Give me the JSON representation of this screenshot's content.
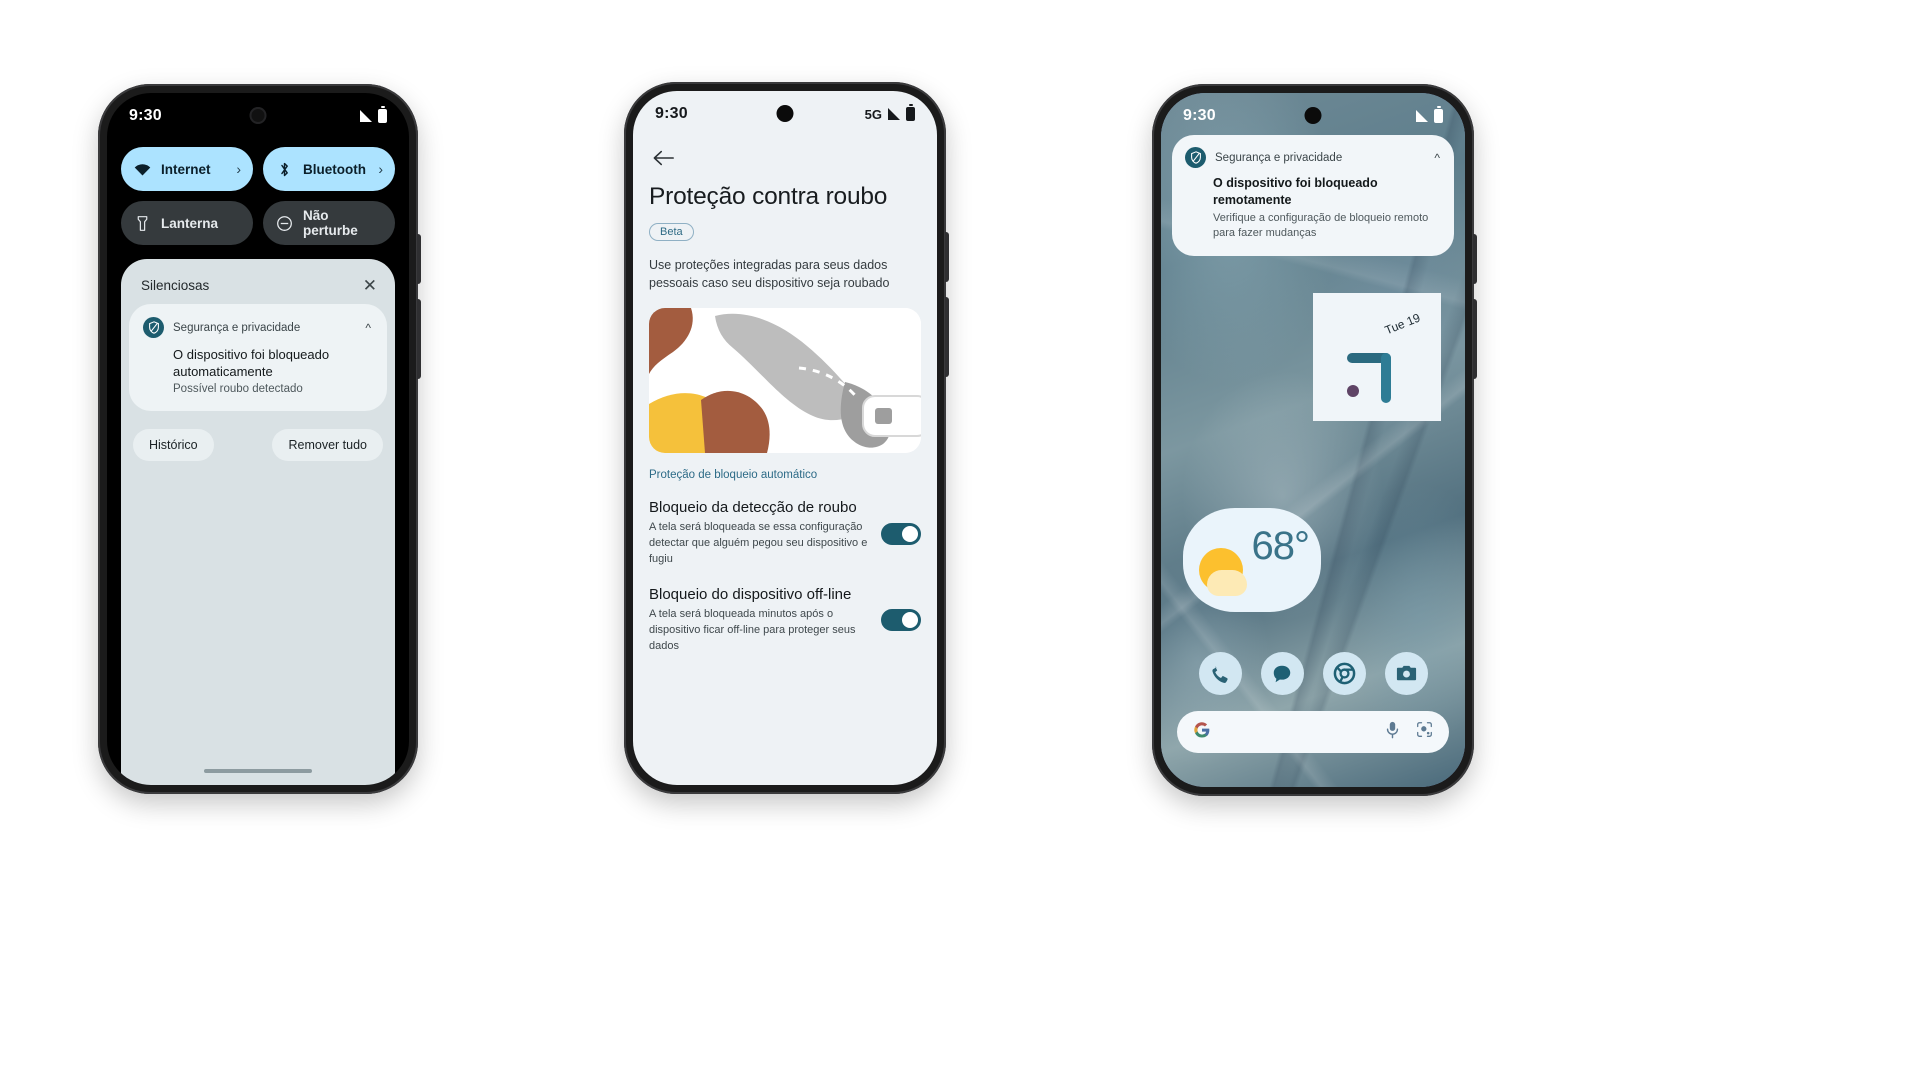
{
  "phone1": {
    "status": {
      "time": "9:30",
      "signal_icon": "signal-bars-icon",
      "battery_icon": "battery-icon"
    },
    "quick_settings": [
      {
        "label": "Internet",
        "icon": "wifi-icon",
        "state": "on",
        "chevron": "›"
      },
      {
        "label": "Bluetooth",
        "icon": "bluetooth-icon",
        "state": "on",
        "chevron": "›"
      },
      {
        "label": "Lanterna",
        "icon": "flashlight-icon",
        "state": "off",
        "chevron": ""
      },
      {
        "label": "Não perturbe",
        "icon": "do-not-disturb-icon",
        "state": "off",
        "chevron": ""
      }
    ],
    "shade": {
      "section_title": "Silenciosas",
      "close_icon": "close-icon",
      "notification": {
        "app": "Segurança e privacidade",
        "app_icon": "shield-icon",
        "collapse_icon": "chevron-up-icon",
        "title": "O dispositivo foi bloqueado automaticamente",
        "subtitle": "Possível roubo detectado"
      },
      "actions": {
        "history": "Histórico",
        "clear_all": "Remover tudo"
      }
    }
  },
  "phone2": {
    "status": {
      "time": "9:30",
      "network": "5G",
      "signal_icon": "signal-bars-icon",
      "battery_icon": "battery-icon"
    },
    "back_icon": "back-arrow-icon",
    "title": "Proteção contra roubo",
    "badge": "Beta",
    "description": "Use proteções integradas para seus dados pessoais caso seu dispositivo seja roubado",
    "hero_illustration": "hand-grabbing-phone-illustration",
    "section_link": "Proteção de bloqueio automático",
    "settings": [
      {
        "title": "Bloqueio da detecção de roubo",
        "subtitle": "A tela será bloqueada se essa configuração detectar que alguém pegou seu dispositivo e fugiu",
        "toggle": "on"
      },
      {
        "title": "Bloqueio do dispositivo off-line",
        "subtitle": "A tela será bloqueada minutos após o dispositivo ficar off-line para proteger seus dados",
        "toggle": "on"
      }
    ]
  },
  "phone3": {
    "status": {
      "time": "9:30",
      "signal_icon": "signal-bars-icon",
      "battery_icon": "battery-icon"
    },
    "notification": {
      "app": "Segurança e privacidade",
      "app_icon": "shield-icon",
      "collapse_icon": "chevron-up-icon",
      "title": "O dispositivo foi bloqueado remotamente",
      "subtitle": "Verifique a configuração de bloqueio remoto para fazer mudanças"
    },
    "clock_widget": {
      "date": "Tue 19"
    },
    "weather_widget": {
      "temperature": "68°",
      "condition_icon": "sun-behind-cloud-icon"
    },
    "dock": [
      {
        "label": "Phone",
        "icon": "phone-icon"
      },
      {
        "label": "Messages",
        "icon": "message-bubble-icon"
      },
      {
        "label": "Chrome",
        "icon": "chrome-icon"
      },
      {
        "label": "Camera",
        "icon": "camera-icon"
      }
    ],
    "search": {
      "logo_icon": "google-g-icon",
      "mic_icon": "microphone-icon",
      "lens_icon": "google-lens-icon"
    }
  },
  "colors": {
    "accent_teal": "#1d5c6e",
    "tile_on": "#ace3ff",
    "tile_off": "#353a3d",
    "shade_bg": "#d9e1e4",
    "page_bg": "#eef2f5",
    "link": "#2d6b87"
  }
}
